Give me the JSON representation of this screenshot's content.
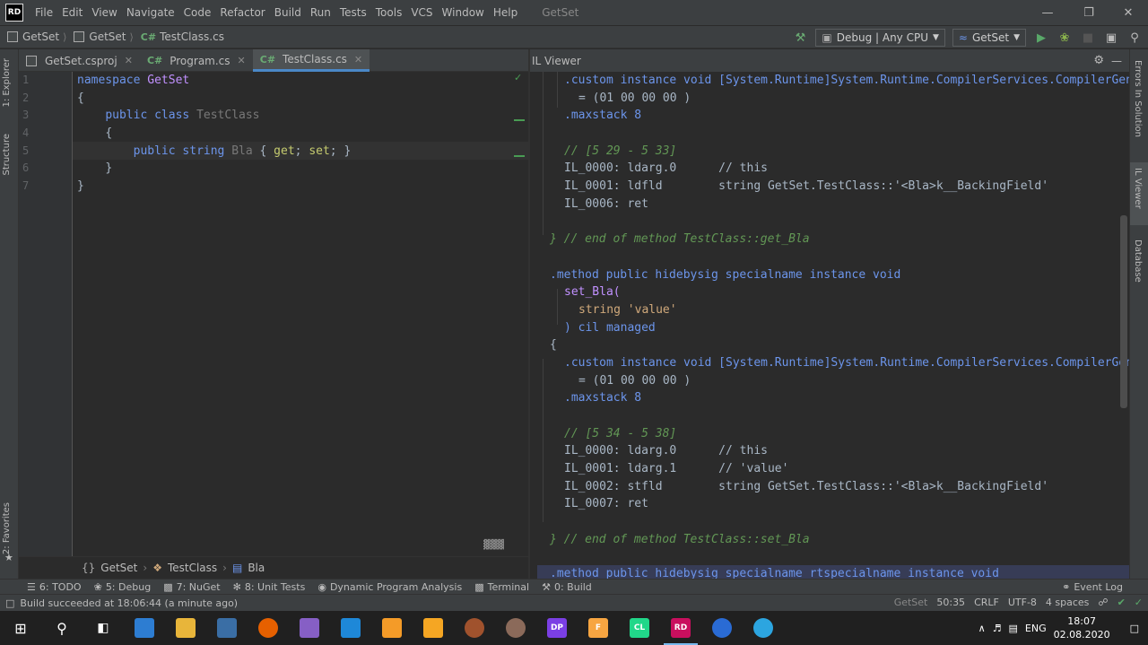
{
  "menubar": {
    "logo": "RD",
    "items": [
      "File",
      "Edit",
      "View",
      "Navigate",
      "Code",
      "Refactor",
      "Build",
      "Run",
      "Tests",
      "Tools",
      "VCS",
      "Window",
      "Help"
    ],
    "title": "GetSet"
  },
  "navbar": {
    "crumbs": [
      "GetSet",
      "GetSet",
      "TestClass.cs"
    ],
    "configuration": "Debug | Any CPU",
    "run_target": "GetSet"
  },
  "left_strip": {
    "explorer": "1: Explorer",
    "structure": "Structure",
    "favorites": "2: Favorites"
  },
  "editor_tabs": [
    {
      "label": "GetSet.csproj",
      "active": false
    },
    {
      "label": "Program.cs",
      "active": false
    },
    {
      "label": "TestClass.cs",
      "active": true
    }
  ],
  "editor": {
    "line_numbers": [
      "1",
      "2",
      "3",
      "4",
      "5",
      "6",
      "7"
    ],
    "line1": {
      "kw": "namespace",
      "name": "GetSet"
    },
    "line2": "{",
    "line3": {
      "kw": "public class",
      "name": "TestClass"
    },
    "line4": "{",
    "line5": {
      "mod": "public string",
      "name": "Bla",
      "open": " { ",
      "get": "get",
      "semi1": "; ",
      "set": "set",
      "close": "; }"
    },
    "line6": "}",
    "line7": "}"
  },
  "editor_breadcrumb": [
    "GetSet",
    "TestClass",
    "Bla"
  ],
  "il_viewer": {
    "title": "IL Viewer",
    "lines": [
      ".custom instance void [System.Runtime]System.Runtime.CompilerServices.CompilerGenera",
      "= (01 00 00 00 )",
      ".maxstack 8",
      "// [5 29 - 5 33]",
      "IL_0000: ldarg.0      // this",
      "IL_0001: ldfld        string GetSet.TestClass::'<Bla>k__BackingField'",
      "IL_0006: ret",
      "} // end of method TestClass::get_Bla",
      ".method public hidebysig specialname instance void",
      "set_Bla(",
      "string 'value'",
      ") cil managed",
      "{",
      ".custom instance void [System.Runtime]System.Runtime.CompilerServices.CompilerGenera",
      "= (01 00 00 00 )",
      ".maxstack 8",
      "// [5 34 - 5 38]",
      "IL_0000: ldarg.0      // this",
      "IL_0001: ldarg.1      // 'value'",
      "IL_0002: stfld        string GetSet.TestClass::'<Bla>k__BackingField'",
      "IL_0007: ret",
      "} // end of method TestClass::set_Bla",
      ".method public hidebysig specialname rtspecialname instance void"
    ]
  },
  "right_strip": {
    "errors": "Errors In Solution",
    "il": "IL Viewer",
    "database": "Database"
  },
  "toolwin_bar": [
    "6: TODO",
    "5: Debug",
    "7: NuGet",
    "8: Unit Tests",
    "Dynamic Program Analysis",
    "Terminal",
    "0: Build",
    "Event Log"
  ],
  "statusbar": {
    "message": "Build succeeded at 18:06:44 (a minute ago)",
    "project": "GetSet",
    "position": "50:35",
    "line_ending": "CRLF",
    "encoding": "UTF-8",
    "indent": "4 spaces"
  },
  "taskbar": {
    "lang": "ENG",
    "time": "18:07",
    "date": "02.08.2020"
  },
  "colors": {
    "accent": "#4a88c7",
    "keyword": "#cc7832",
    "comment": "#629755",
    "success": "#499c54"
  }
}
